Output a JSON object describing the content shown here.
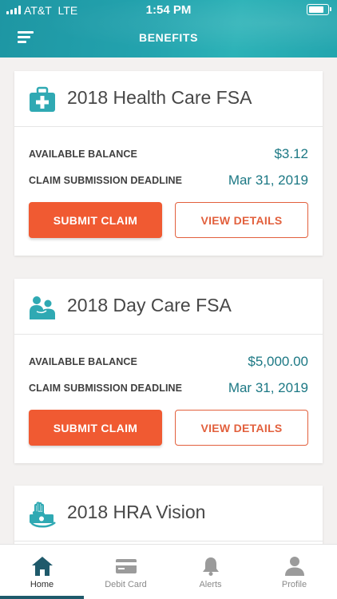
{
  "status_bar": {
    "carrier": "AT&T",
    "network": "LTE",
    "time": "1:54 PM"
  },
  "header": {
    "title": "BENEFITS",
    "menu_icon": "hamburger-menu-icon"
  },
  "colors": {
    "header": "#23a3ae",
    "accent": "#f05a32",
    "value_text": "#1c7884",
    "active_tab": "#1f5a6b"
  },
  "benefits": [
    {
      "icon": "medical-kit-icon",
      "title": "2018 Health Care FSA",
      "balance_label": "AVAILABLE BALANCE",
      "balance_value": "$3.12",
      "deadline_label": "CLAIM SUBMISSION DEADLINE",
      "deadline_value": "Mar 31, 2019",
      "submit_label": "SUBMIT CLAIM",
      "details_label": "VIEW DETAILS"
    },
    {
      "icon": "family-icon",
      "title": "2018 Day Care FSA",
      "balance_label": "AVAILABLE BALANCE",
      "balance_value": "$5,000.00",
      "deadline_label": "CLAIM SUBMISSION DEADLINE",
      "deadline_value": "Mar 31, 2019",
      "submit_label": "SUBMIT CLAIM",
      "details_label": "VIEW DETAILS"
    },
    {
      "icon": "hand-money-icon",
      "title": "2018 HRA Vision"
    }
  ],
  "tabs": [
    {
      "label": "Home",
      "icon": "home-icon",
      "active": true
    },
    {
      "label": "Debit Card",
      "icon": "credit-card-icon",
      "active": false
    },
    {
      "label": "Alerts",
      "icon": "bell-icon",
      "active": false
    },
    {
      "label": "Profile",
      "icon": "person-icon",
      "active": false
    }
  ]
}
